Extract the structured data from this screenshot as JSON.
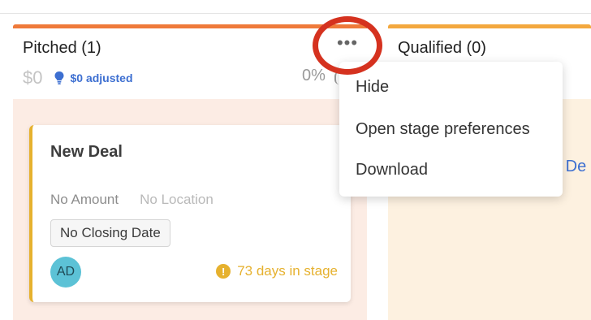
{
  "colors": {
    "pitched_bar": "#ef7a3a",
    "qualified_bar": "#f3a83e",
    "accent_blue": "#3d6fd1",
    "stage_warning": "#e6b12e",
    "highlight_circle": "#d5321f"
  },
  "columns": [
    {
      "title": "Pitched (1)",
      "amount": "$0",
      "adjusted": "$0 adjusted",
      "percent": "0%"
    },
    {
      "title": "Qualified (0)",
      "add_deal_partial": "d De"
    }
  ],
  "more_button": {
    "icon": "more-horizontal-icon",
    "label": "•••"
  },
  "card": {
    "title": "New Deal",
    "amount": "No Amount",
    "location": "No Location",
    "closing_date": "No Closing Date",
    "avatar_initials": "AD",
    "stage_days": "73 days in stage",
    "warning_icon": "!"
  },
  "menu": {
    "items": [
      "Hide",
      "Open stage preferences",
      "Download"
    ]
  }
}
